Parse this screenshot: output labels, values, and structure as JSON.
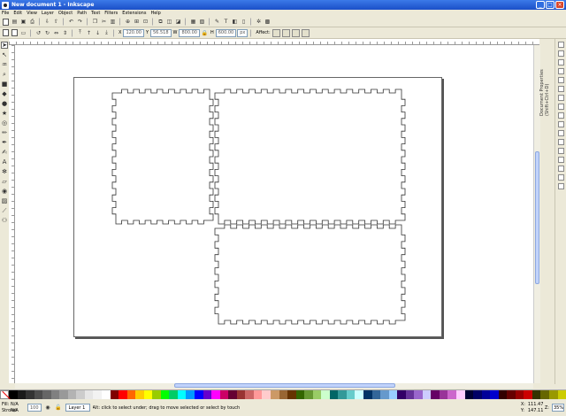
{
  "window": {
    "title": "New document 1 - Inkscape",
    "minimize": "_",
    "maximize": "□",
    "close": "×"
  },
  "menu": [
    "File",
    "Edit",
    "View",
    "Layer",
    "Object",
    "Path",
    "Text",
    "Filters",
    "Extensions",
    "Help"
  ],
  "controls": {
    "x_value": "120.00",
    "y_value": "56.518",
    "w_value": "800.00",
    "h_value": "600.00",
    "unit": "px",
    "affect_label": "Affect:"
  },
  "docked_panel_tab": "Document Properties (Shift+Ctrl+D)",
  "status": {
    "fill_label": "Fill:",
    "fill_value": "N/A",
    "stroke_label": "Stroke:",
    "stroke_value": "N/A",
    "opacity": "100",
    "layer": "Layer 1",
    "message": "Alt: click to select under; drag to move selected or select by touch",
    "x_label": "X:",
    "x_coord": "111.47",
    "y_label": "Y:",
    "y_coord": "147.11",
    "z_label": "Z:",
    "zoom": "35%"
  },
  "palette_colors": [
    "#000000",
    "#1a1a1a",
    "#333333",
    "#4d4d4d",
    "#666666",
    "#808080",
    "#999999",
    "#b3b3b3",
    "#cccccc",
    "#e6e6e6",
    "#f2f2f2",
    "#ffffff",
    "#800000",
    "#ff0000",
    "#ff6600",
    "#ffcc00",
    "#ffff00",
    "#99cc00",
    "#00ff00",
    "#00cc66",
    "#00ffff",
    "#0099ff",
    "#0000ff",
    "#6600cc",
    "#ff00ff",
    "#cc0066",
    "#660033",
    "#993333",
    "#cc6666",
    "#ff9999",
    "#ffcccc",
    "#cc9966",
    "#996633",
    "#663300",
    "#336600",
    "#669933",
    "#99cc66",
    "#ccffcc",
    "#006666",
    "#339999",
    "#66cccc",
    "#ccffff",
    "#003366",
    "#336699",
    "#6699cc",
    "#99ccff",
    "#330066",
    "#663399",
    "#9966cc",
    "#ccccff",
    "#660066",
    "#993399",
    "#cc66cc",
    "#ffccff",
    "#000033",
    "#000066",
    "#000099",
    "#0000cc",
    "#330000",
    "#660000",
    "#990000",
    "#cc0000",
    "#333300",
    "#666600",
    "#999900",
    "#cccc00"
  ]
}
